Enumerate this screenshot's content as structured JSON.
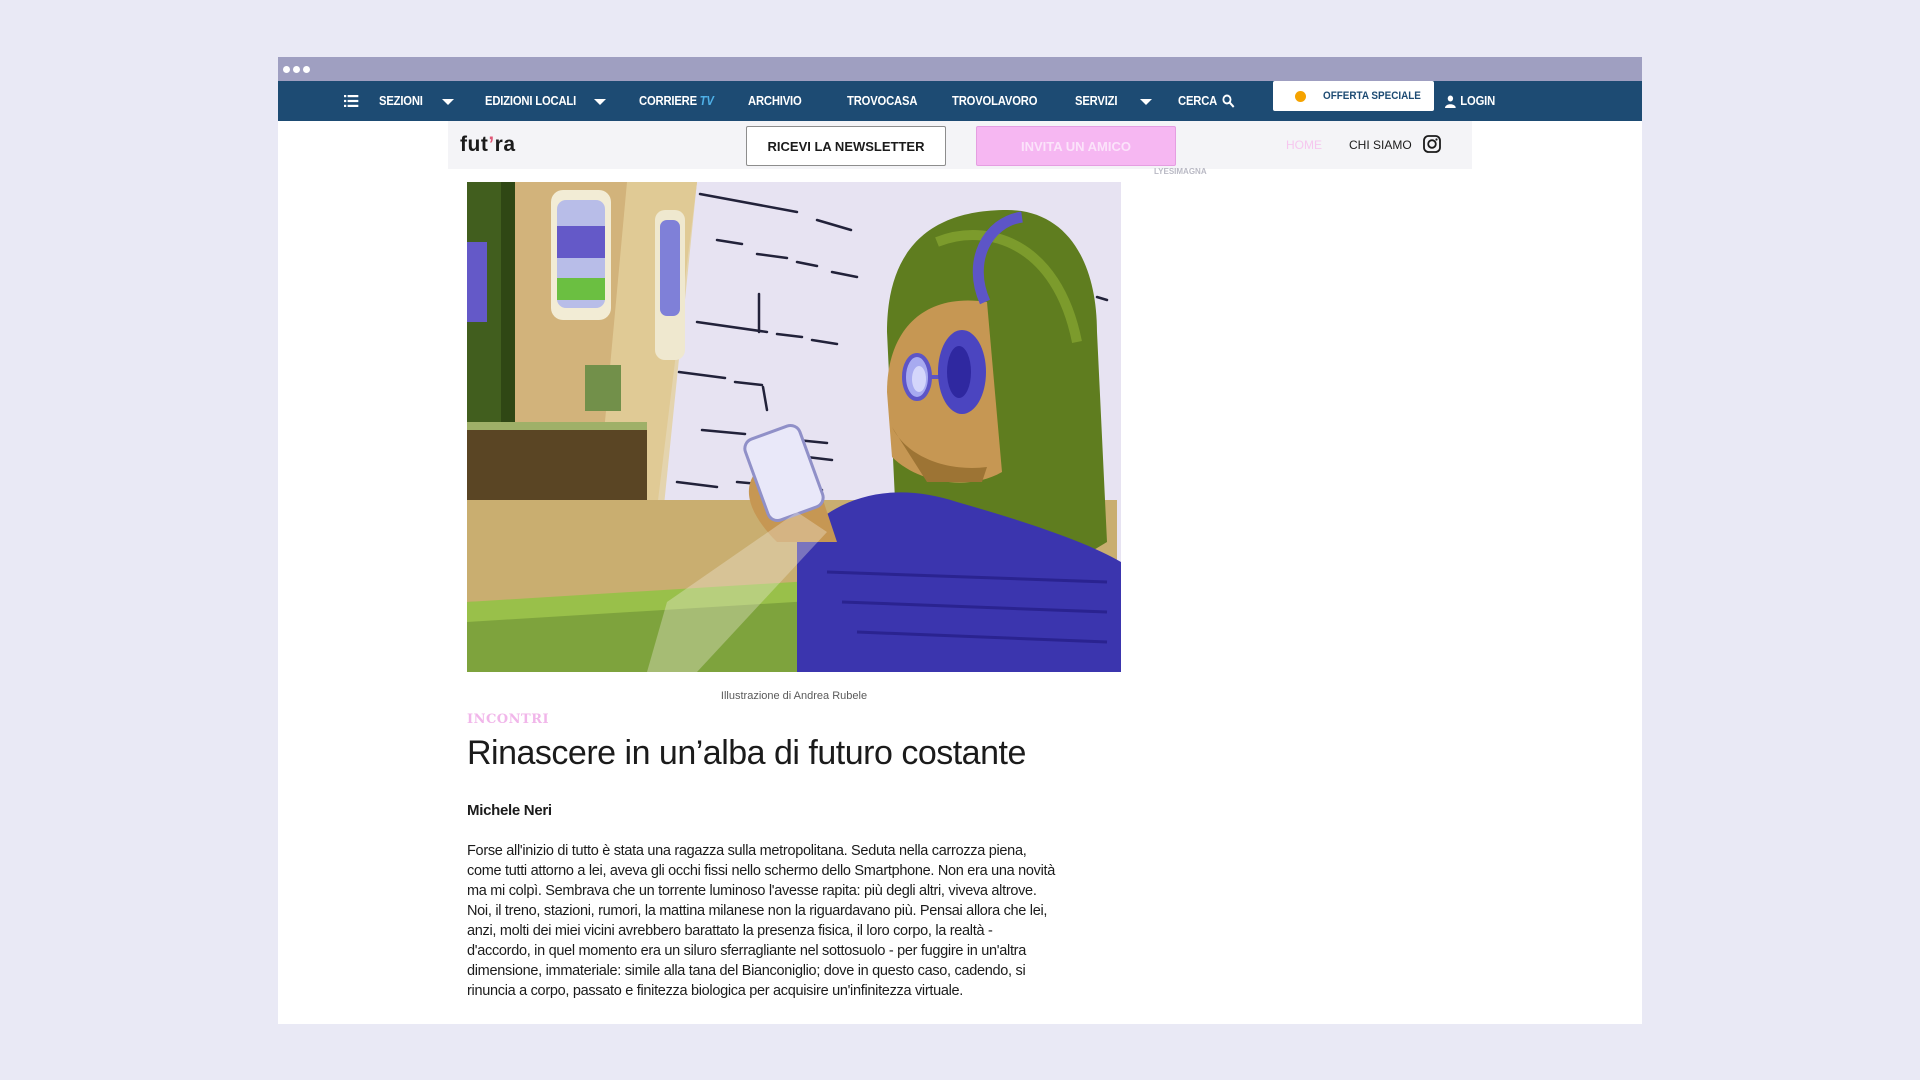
{
  "window": {
    "dots": 3
  },
  "nav": {
    "menu_icon": "hamburger-menu-icon",
    "sezioni": "SEZIONI",
    "edizioni_locali": "EDIZIONI LOCALI",
    "corriere": "CORRIERE",
    "corriere_tv": "TV",
    "archivio": "ARCHIVIO",
    "trovocasa": "TROVOCASA",
    "trovolavoro": "TROVOLAVORO",
    "servizi": "SERVIZI",
    "cerca": "CERCA",
    "search_icon": "search-icon",
    "offerta": "OFFERTA SPECIALE",
    "login": "LOGIN",
    "user_icon": "user-icon",
    "bg_color": "#1d4b73"
  },
  "subnav": {
    "logo_a": "fut",
    "logo_tick": "’",
    "logo_b": "ra",
    "newsletter_button": "RICEVI LA NEWSLETTER",
    "invite_button": "INVITA UN AMICO",
    "home": "HOME",
    "chi_siamo": "CHI SIAMO",
    "instagram_icon": "instagram-icon",
    "side_snippet": "LYESIMAGNA"
  },
  "article": {
    "image_caption": "Illustrazione di Andrea Rubele",
    "category": "INCONTRI",
    "title": "Rinascere in un’alba di futuro costante",
    "author": "Michele Neri",
    "body_lines": [
      "Forse all'inizio di tutto è stata una ragazza sulla metropolitana. Seduta nella carrozza piena,",
      "come tutti attorno a lei, aveva gli occhi fissi nello schermo dello Smartphone. Non era una novità",
      "ma mi colpì. Sembrava che un torrente luminoso l'avesse rapita: più degli altri, viveva altrove.",
      "Noi, il treno, stazioni, rumori, la mattina milanese non la riguardavano più. Pensai allora che lei,",
      "anzi, molti dei miei vicini avrebbero barattato la presenza fisica, il loro corpo, la realtà -",
      "d'accordo, in quel momento era un siluro sferragliante nel sottosuolo - per fuggire in un'altra",
      "dimensione, immateriale: simile alla tana del Bianconiglio; dove in questo caso, cadendo, si",
      "rinuncia a corpo, passato e finitezza biologica per acquisire un'infinitezza virtuale."
    ]
  },
  "colors": {
    "accent_pink": "#f6b7f2",
    "nav_blue": "#1d4b73",
    "offer_dot": "#f5a300"
  }
}
